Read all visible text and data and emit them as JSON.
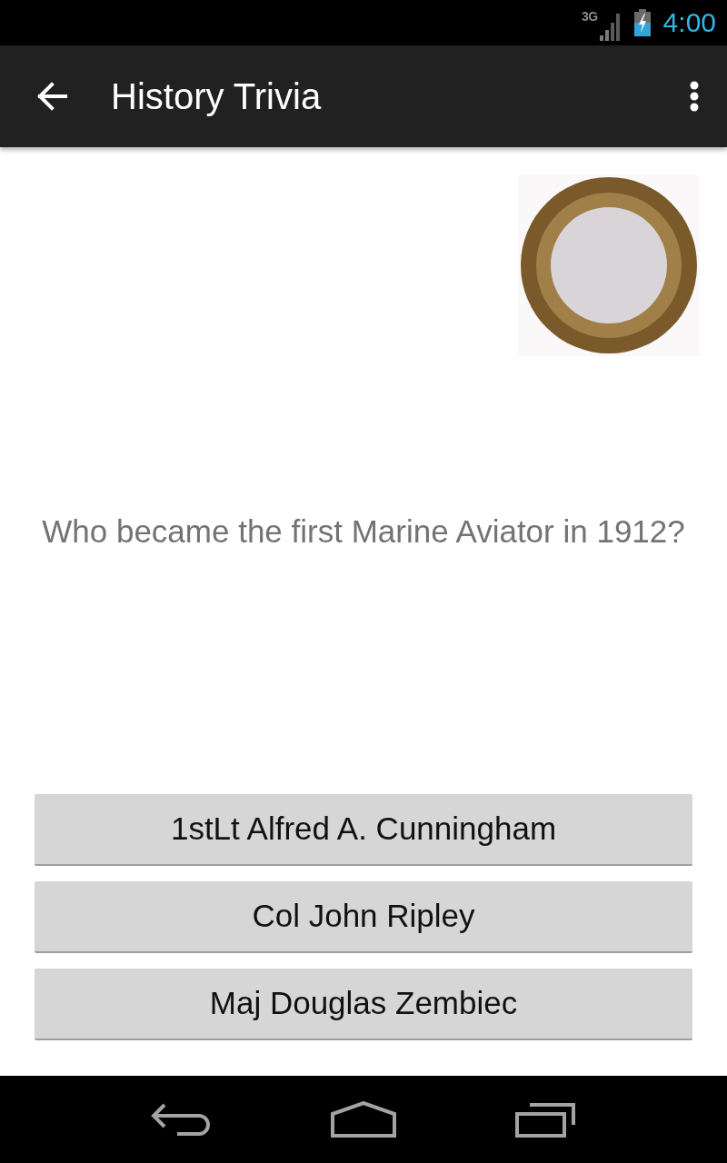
{
  "status_bar": {
    "network": "3G",
    "time": "4:00"
  },
  "app_bar": {
    "title": "History Trivia"
  },
  "question": {
    "text": "Who became the first Marine Aviator in 1912?"
  },
  "answers": [
    {
      "label": "1stLt Alfred A. Cunningham"
    },
    {
      "label": "Col John Ripley"
    },
    {
      "label": "Maj Douglas Zembiec"
    }
  ]
}
